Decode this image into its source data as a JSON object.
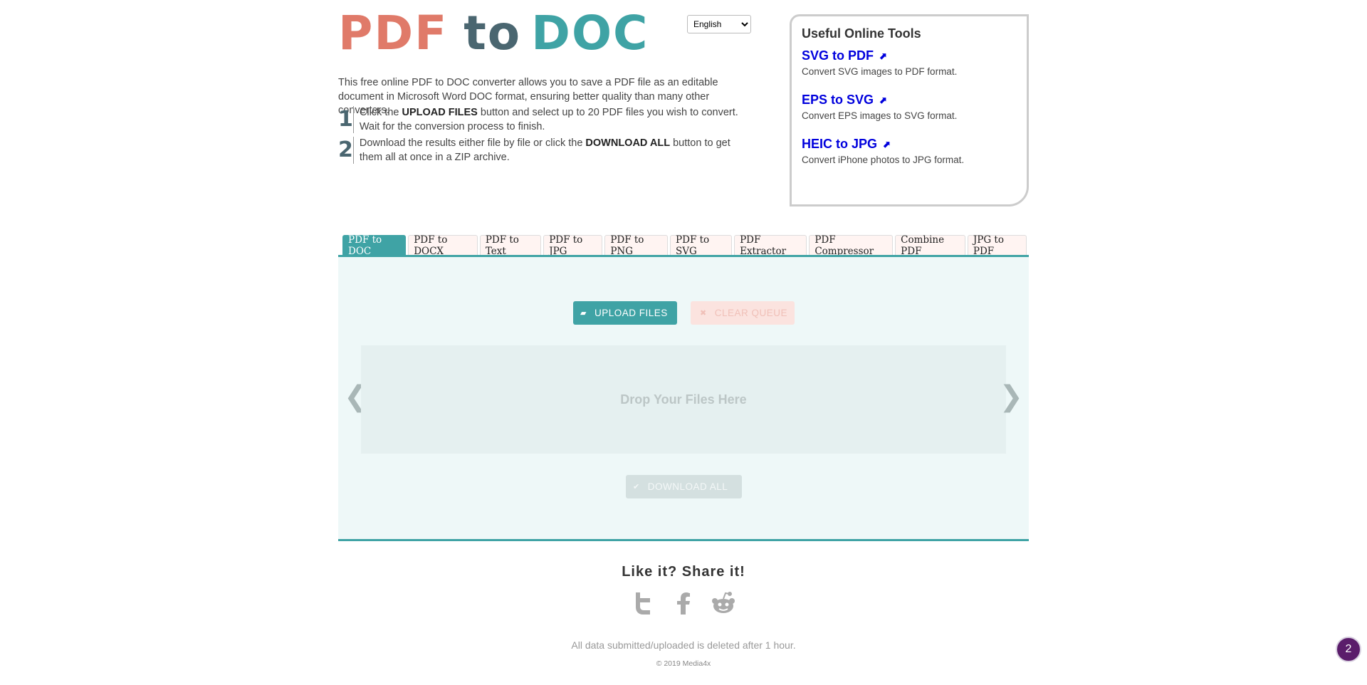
{
  "logo": {
    "pdf": "PDF",
    "to": "to",
    "doc": "DOC"
  },
  "language": {
    "selected": "English"
  },
  "intro": "This free online PDF to DOC converter allows you to save a PDF file as an editable document in Microsoft Word DOC format, ensuring better quality than many other converters.",
  "steps": [
    {
      "num": "1",
      "pre": "Click the ",
      "bold": "UPLOAD FILES",
      "post": " button and select up to 20 PDF files you wish to convert. Wait for the conversion process to finish."
    },
    {
      "num": "2",
      "pre": "Download the results either file by file or click the ",
      "bold": "DOWNLOAD ALL",
      "post": " button to get them all at once in a ZIP archive."
    }
  ],
  "tools": {
    "title": "Useful Online Tools",
    "items": [
      {
        "label": "SVG to PDF",
        "desc": "Convert SVG images to PDF format."
      },
      {
        "label": "EPS to SVG",
        "desc": "Convert EPS images to SVG format."
      },
      {
        "label": "HEIC to JPG",
        "desc": "Convert iPhone photos to JPG format."
      }
    ]
  },
  "tabs": [
    "PDF to DOC",
    "PDF to DOCX",
    "PDF to Text",
    "PDF to JPG",
    "PDF to PNG",
    "PDF to SVG",
    "PDF Extractor",
    "PDF Compressor",
    "Combine PDF",
    "JPG to PDF"
  ],
  "active_tab": "PDF to DOC",
  "buttons": {
    "upload": "UPLOAD FILES",
    "clear": "CLEAR QUEUE",
    "download_all": "DOWNLOAD ALL"
  },
  "dropzone": {
    "text": "Drop Your Files Here"
  },
  "share": {
    "title": "Like it? Share it!",
    "icons": [
      "twitter-icon",
      "facebook-icon",
      "reddit-icon"
    ]
  },
  "footer": {
    "note": "All data submitted/uploaded is deleted after 1 hour.",
    "copyright": "© 2019 Media4x"
  },
  "badge": {
    "count": "2"
  },
  "colors": {
    "accent": "#3fa3a5",
    "pdf": "#e07a69",
    "dark": "#4a6670",
    "link": "#0000dd"
  }
}
